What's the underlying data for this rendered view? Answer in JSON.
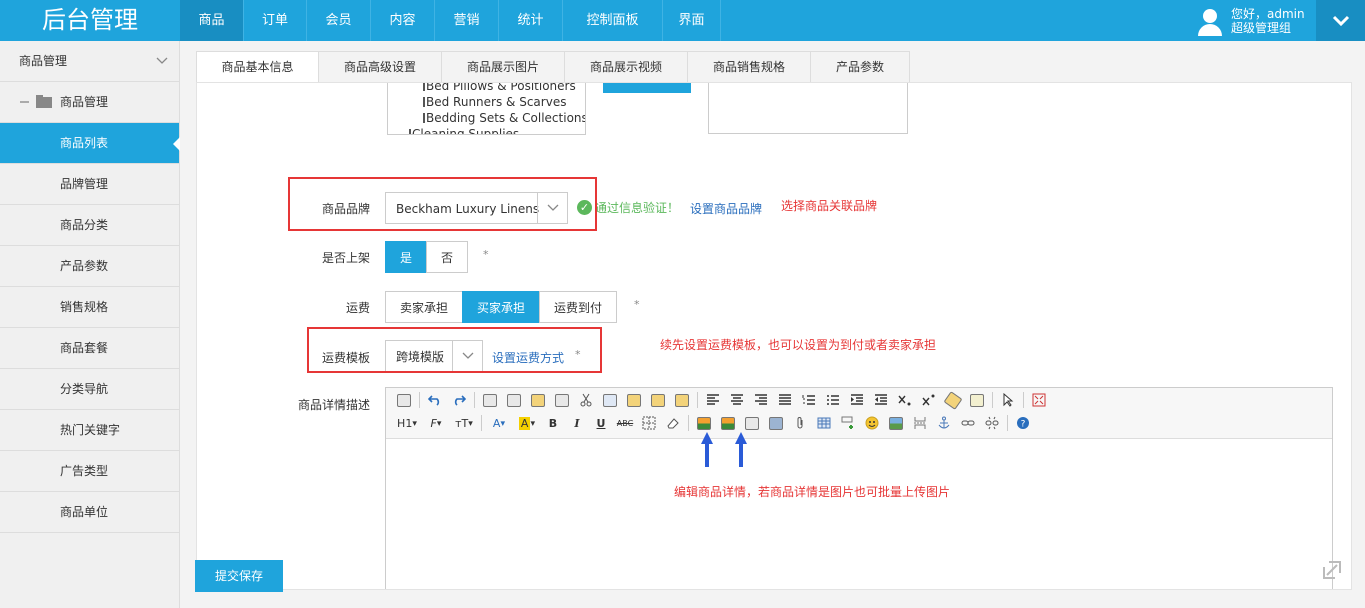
{
  "app": {
    "title": "后台管理"
  },
  "nav": {
    "items": [
      "商品",
      "订单",
      "会员",
      "内容",
      "营销",
      "统计",
      "控制面板",
      "界面"
    ],
    "active": "商品"
  },
  "user": {
    "greeting": "您好，admin",
    "role": "超级管理组"
  },
  "sidebar": {
    "section": "商品管理",
    "group": "商品管理",
    "items": [
      "商品列表",
      "品牌管理",
      "商品分类",
      "产品参数",
      "销售规格",
      "商品套餐",
      "分类导航",
      "热门关键字",
      "广告类型",
      "商品单位"
    ],
    "active": "商品列表"
  },
  "tabs": [
    "商品基本信息",
    "商品高级设置",
    "商品展示图片",
    "商品展示视频",
    "商品销售规格",
    "产品参数"
  ],
  "category_list": [
    "Bed Pillows & Positioners",
    "Bed Runners & Scarves",
    "Bedding Sets & Collections",
    "Cleaning Supplies"
  ],
  "form": {
    "brand": {
      "label": "商品品牌",
      "value": "Beckham Luxury Linens",
      "verify": "通过信息验证！",
      "link": "设置商品品牌"
    },
    "on_sale": {
      "label": "是否上架",
      "options": [
        "是",
        "否"
      ],
      "selected": "是",
      "star": "*"
    },
    "shipping": {
      "label": "运费",
      "options": [
        "卖家承担",
        "买家承担",
        "运费到付"
      ],
      "selected": "买家承担",
      "star": "*"
    },
    "template": {
      "label": "运费模板",
      "value": "跨境模版",
      "link": "设置运费方式",
      "star": "*"
    },
    "detail": {
      "label": "商品详情描述"
    }
  },
  "annotations": {
    "brand": "选择商品关联品牌",
    "template": "续先设置运费模板，也可以设置为到付或者卖家承担",
    "editor": "编辑商品详情，若商品详情是图片也可批量上传图片"
  },
  "toolbar_text": {
    "heading": "H1",
    "font": "F",
    "size": "тT",
    "color_a": "A",
    "highlight_a": "A",
    "bold": "B",
    "italic": "I",
    "underline": "U",
    "abc": "ABC"
  },
  "buttons": {
    "submit": "提交保存"
  },
  "colors": {
    "primary": "#1fa4dc",
    "annotation": "#e63636",
    "success": "#5cb85c",
    "link": "#2a6ebd"
  }
}
